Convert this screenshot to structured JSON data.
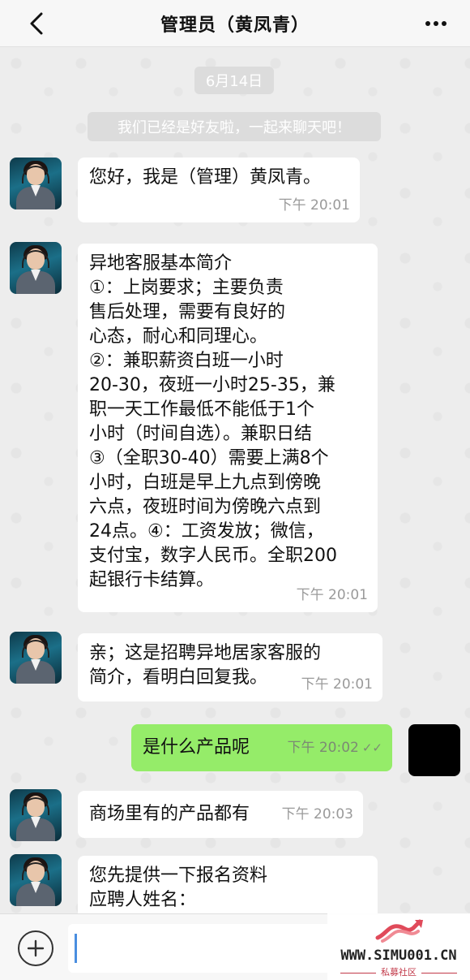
{
  "header": {
    "title": "管理员（黄凤青）",
    "back_icon": "chevron-left-icon",
    "more_icon": "more-dots-icon"
  },
  "chat": {
    "date_label": "6月14日",
    "system_notice": "我们已经是好友啦，一起来聊天吧！",
    "messages": [
      {
        "sender": "contact",
        "text": "您好，我是（管理）黄凤青。",
        "time": "下午 20:01"
      },
      {
        "sender": "contact",
        "text": "异地客服基本简介\n①：上岗要求；主要负责\n售后处理，需要有良好的\n心态，耐心和同理心。\n②：兼职薪资白班一小时\n20-30，夜班一小时25-35，兼\n职一天工作最低不能低于1个\n小时（时间自选）。兼职日结\n③（全职30-40）需要上满8个\n小时，白班是早上九点到傍晚\n六点，夜班时间为傍晚六点到\n24点。④：工资发放；微信，\n支付宝，数字人民币。全职200\n起银行卡结算。",
        "time": "下午 20:01"
      },
      {
        "sender": "contact",
        "text": "亲；这是招聘异地居家客服的\n简介，看明白回复我。",
        "time": "下午 20:01"
      },
      {
        "sender": "me",
        "text": "是什么产品呢",
        "time": "下午 20:02",
        "status": "✓✓"
      },
      {
        "sender": "contact",
        "text": "商场里有的产品都有",
        "time": "下午 20:03"
      },
      {
        "sender": "contact",
        "text": "您先提供一下报名资料\n应聘人姓名：",
        "time": ""
      }
    ]
  },
  "input_bar": {
    "plus_icon": "plus-circle-icon",
    "input_value": ""
  },
  "watermark": {
    "url": "WWW.SIMU001.CN",
    "subtitle": "私募社区"
  },
  "colors": {
    "me_bubble": "#95ec69",
    "contact_bubble": "#ffffff",
    "chat_bg": "#ededed",
    "header_bg": "#f7f7f7"
  }
}
